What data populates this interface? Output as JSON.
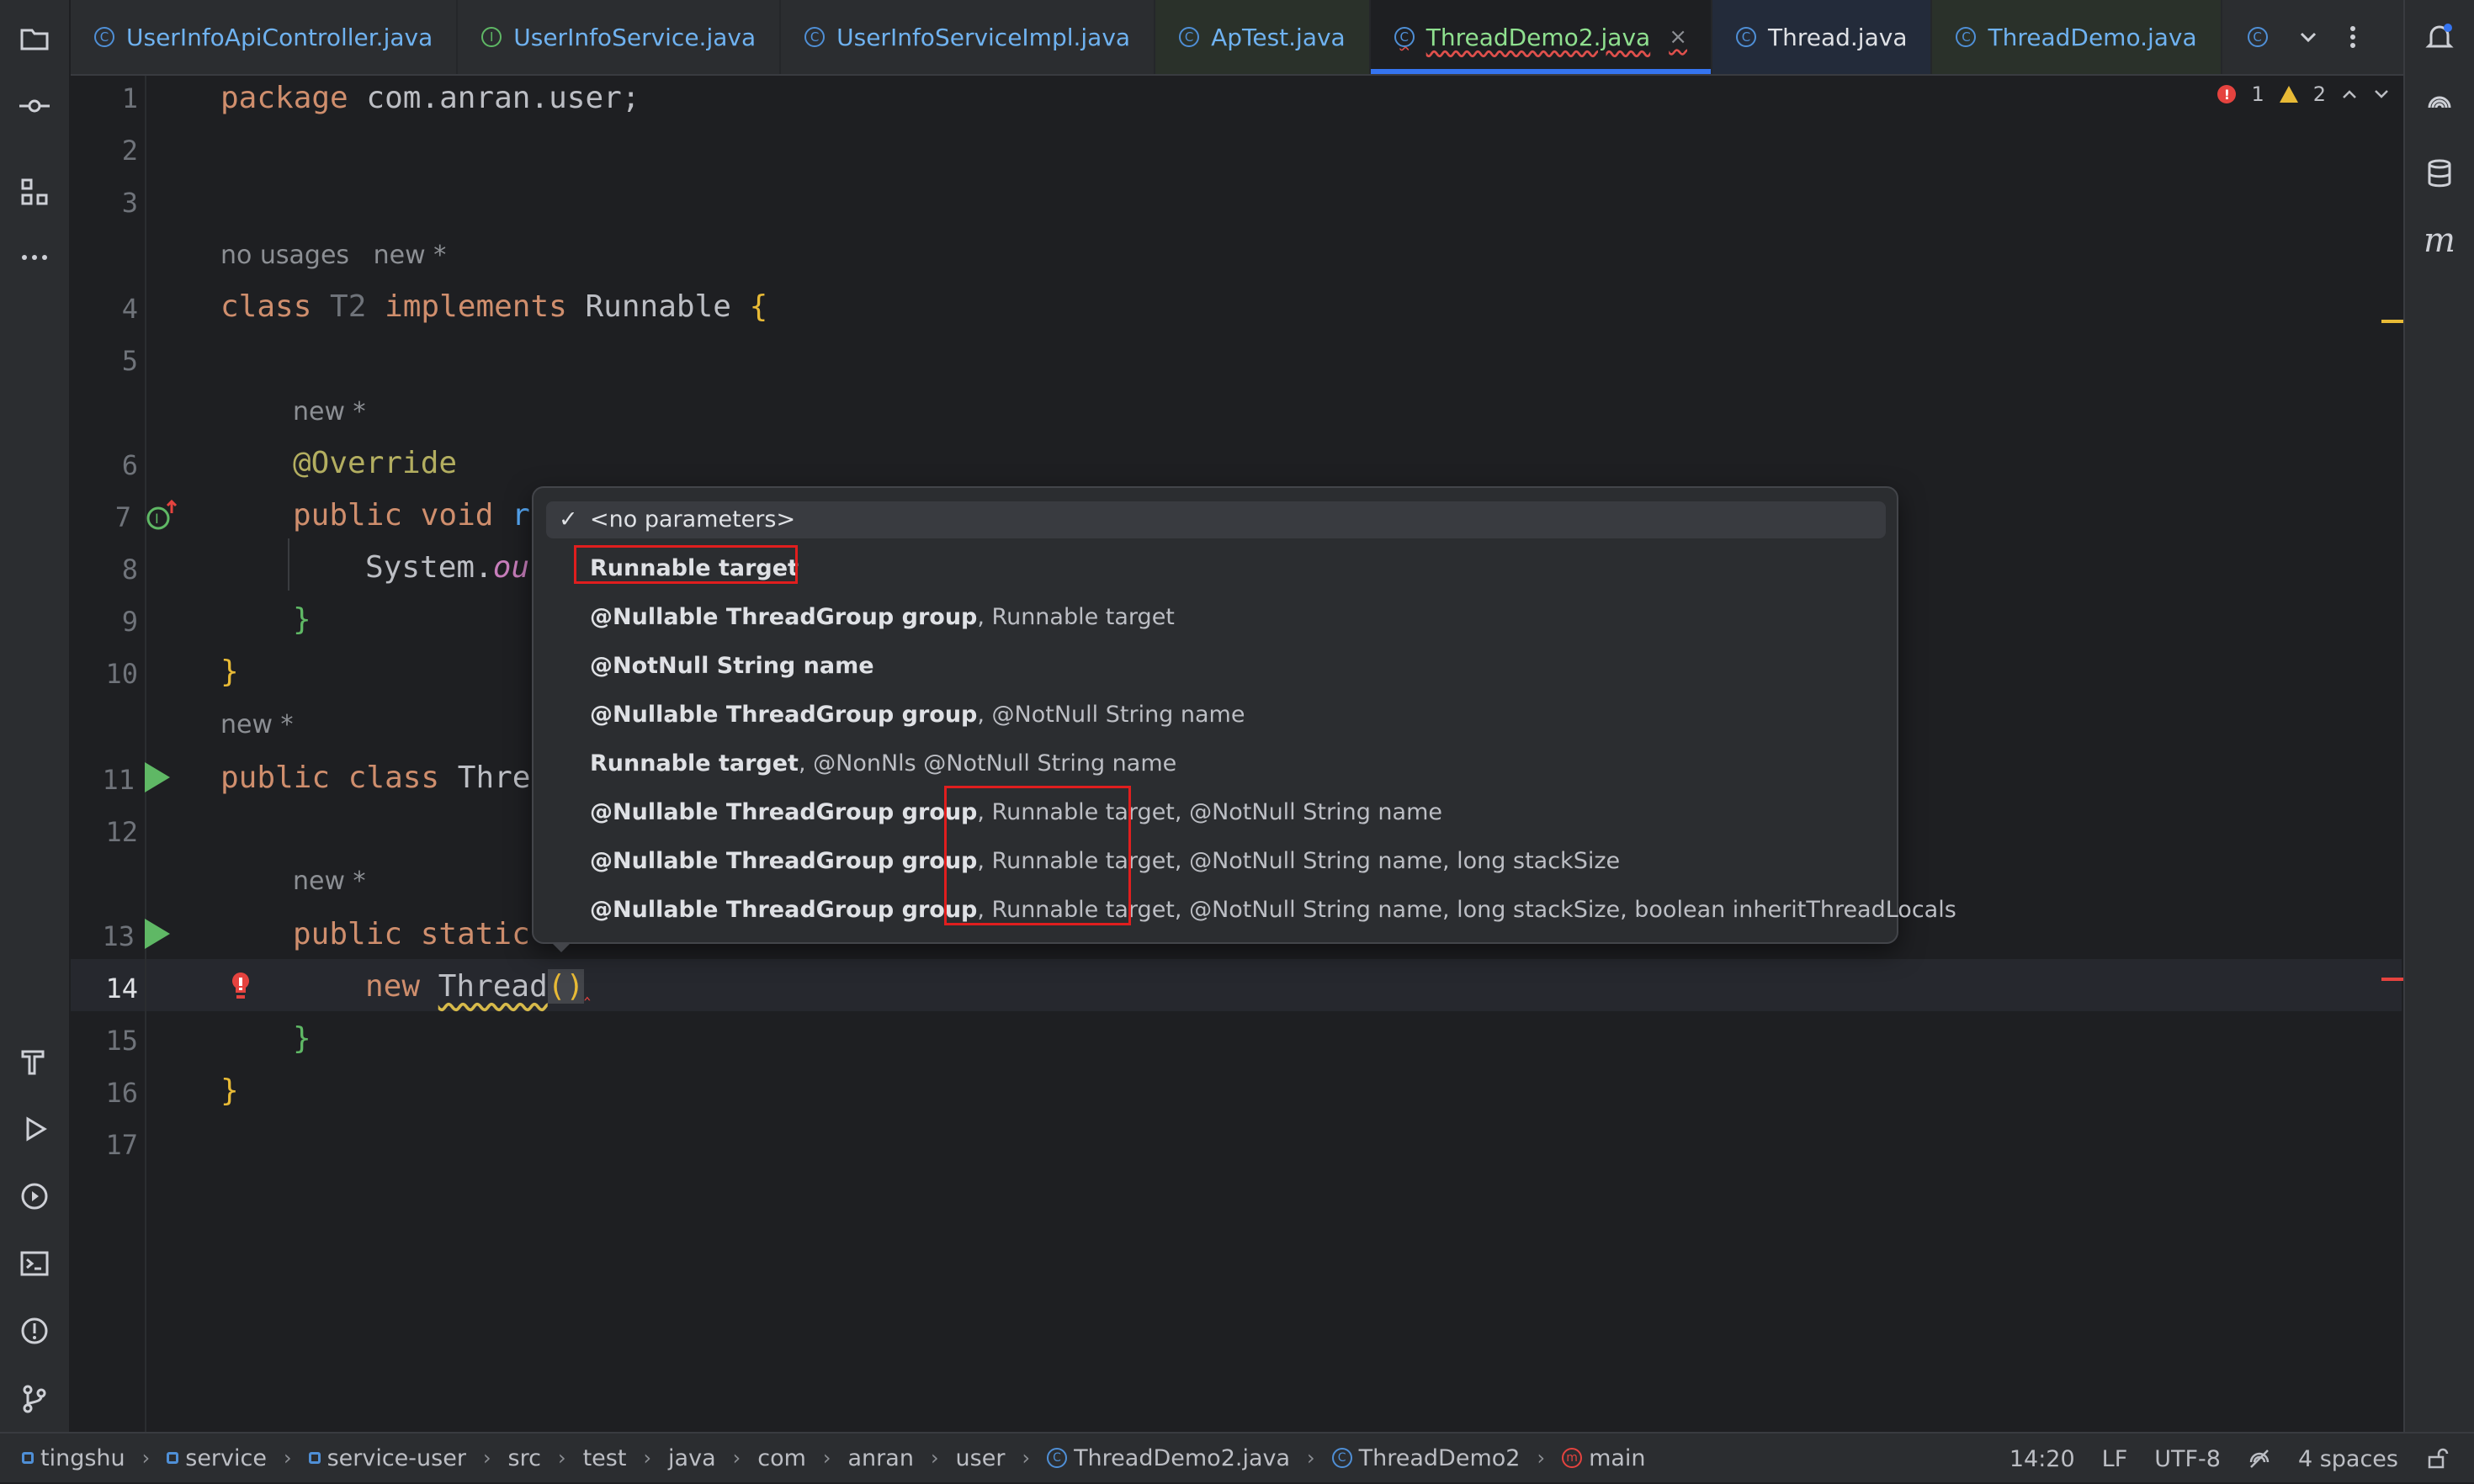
{
  "tabs": [
    {
      "label": "UserInfoApiController.java",
      "kind": "class",
      "style": "normal"
    },
    {
      "label": "UserInfoService.java",
      "kind": "iface",
      "style": "normal"
    },
    {
      "label": "UserInfoServiceImpl.java",
      "kind": "class",
      "style": "normal"
    },
    {
      "label": "ApTest.java",
      "kind": "class",
      "style": "mod-green"
    },
    {
      "label": "ThreadDemo2.java",
      "kind": "class",
      "style": "active"
    },
    {
      "label": "Thread.java",
      "kind": "class",
      "style": "white mod-blue"
    },
    {
      "label": "ThreadDemo.java",
      "kind": "class",
      "style": "mod-green"
    }
  ],
  "tab_close_glyph": "×",
  "class_glyph": "C",
  "iface_glyph": "I",
  "inspections": {
    "errors": "1",
    "warnings": "2"
  },
  "line_numbers": [
    "1",
    "2",
    "3",
    "4",
    "5",
    "6",
    "7",
    "8",
    "9",
    "10",
    "11",
    "12",
    "13",
    "14",
    "15",
    "16",
    "17"
  ],
  "code": {
    "l1_kw": "package",
    "l1_rest": " com.anran.user;",
    "hint_a": "no usages   new *",
    "l4_class": "class",
    "l4_name": " T2 ",
    "l4_impl": "implements",
    "l4_type": " Runnable ",
    "l4_brace": "{",
    "hint_b": "new *",
    "l6_ann": "@Override",
    "l7_public": "public",
    "l7_void": " void",
    "l7_rest": " r",
    "l8_sys": "System.",
    "l8_fld": "ou",
    "l9_brace": "}",
    "l10_brace": "}",
    "hint_c": "new *",
    "l11_public": "public",
    "l11_class": " class",
    "l11_rest": " Thre",
    "hint_d": "new *",
    "l13_public": "public",
    "l13_static": " static",
    "l14_new": "new",
    "l14_type": "Thread",
    "l14_parens": "()",
    "l15_brace": "}",
    "l16_brace": "}"
  },
  "popup": {
    "check": "✓",
    "rows": [
      {
        "bold": "<no parameters>",
        "rest": ""
      },
      {
        "bold": "Runnable target",
        "rest": ""
      },
      {
        "bold": "@Nullable ThreadGroup group",
        "rest": ", Runnable target"
      },
      {
        "bold": "@NotNull String name",
        "rest": ""
      },
      {
        "bold": "@Nullable ThreadGroup group",
        "rest": ", @NotNull String name"
      },
      {
        "bold": "Runnable target",
        "rest": ", @NonNls @NotNull String name"
      },
      {
        "bold": "@Nullable ThreadGroup group",
        "rest": ", Runnable target, @NotNull String name"
      },
      {
        "bold": "@Nullable ThreadGroup group",
        "rest": ", Runnable target, @NotNull String name, long stackSize"
      },
      {
        "bold": "@Nullable ThreadGroup group",
        "rest": ", Runnable target, @NotNull String name, long stackSize, boolean inheritThreadLocals"
      }
    ]
  },
  "breadcrumbs": {
    "items": [
      "tingshu",
      "service",
      "service-user",
      "src",
      "test",
      "java",
      "com",
      "anran",
      "user",
      "ThreadDemo2.java",
      "ThreadDemo2",
      "main"
    ],
    "sep": "›",
    "method_glyph": "m"
  },
  "status": {
    "position": "14:20",
    "line_sep": "LF",
    "encoding": "UTF-8",
    "indent": "4 spaces"
  },
  "colors": {
    "accent": "#3574f0",
    "error": "#e5433f",
    "warning": "#e8ba36",
    "highlight_box": "#e01e1e"
  }
}
